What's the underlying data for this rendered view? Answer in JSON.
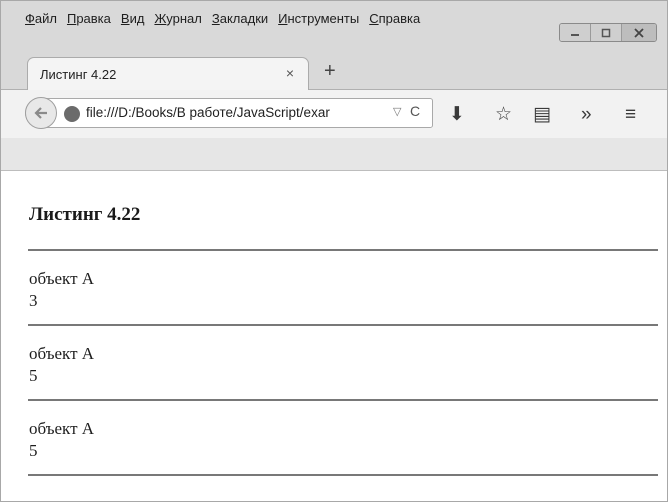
{
  "menu": {
    "items": [
      {
        "accel": "Ф",
        "rest": "айл"
      },
      {
        "accel": "П",
        "rest": "равка"
      },
      {
        "accel": "В",
        "rest": "ид"
      },
      {
        "accel": "Ж",
        "rest": "урнал"
      },
      {
        "accel": "З",
        "rest": "акладки"
      },
      {
        "accel": "И",
        "rest": "нструменты"
      },
      {
        "accel": "С",
        "rest": "правка"
      }
    ]
  },
  "tab": {
    "title": "Листинг 4.22",
    "close": "×",
    "new_tab": "+"
  },
  "nav": {
    "url": "file:///D:/Books/В работе/JavaScript/exar",
    "dropdown_glyph": "▽",
    "reload_glyph": "C",
    "download_glyph": "⬇",
    "bookmark_glyph": "☆",
    "reader_glyph": "▤",
    "overflow_glyph": "»",
    "menu_glyph": "≡"
  },
  "page": {
    "heading": "Листинг 4.22",
    "blocks": [
      {
        "name": "объект А",
        "value": "3"
      },
      {
        "name": "объект А",
        "value": "5"
      },
      {
        "name": "объект А",
        "value": "5"
      }
    ]
  },
  "icons": [
    "back-arrow-icon",
    "globe-icon",
    "download-icon",
    "bookmark-star-icon",
    "reader-icon",
    "overflow-chevron-icon",
    "hamburger-menu-icon",
    "minimize-icon",
    "maximize-icon",
    "close-icon"
  ]
}
